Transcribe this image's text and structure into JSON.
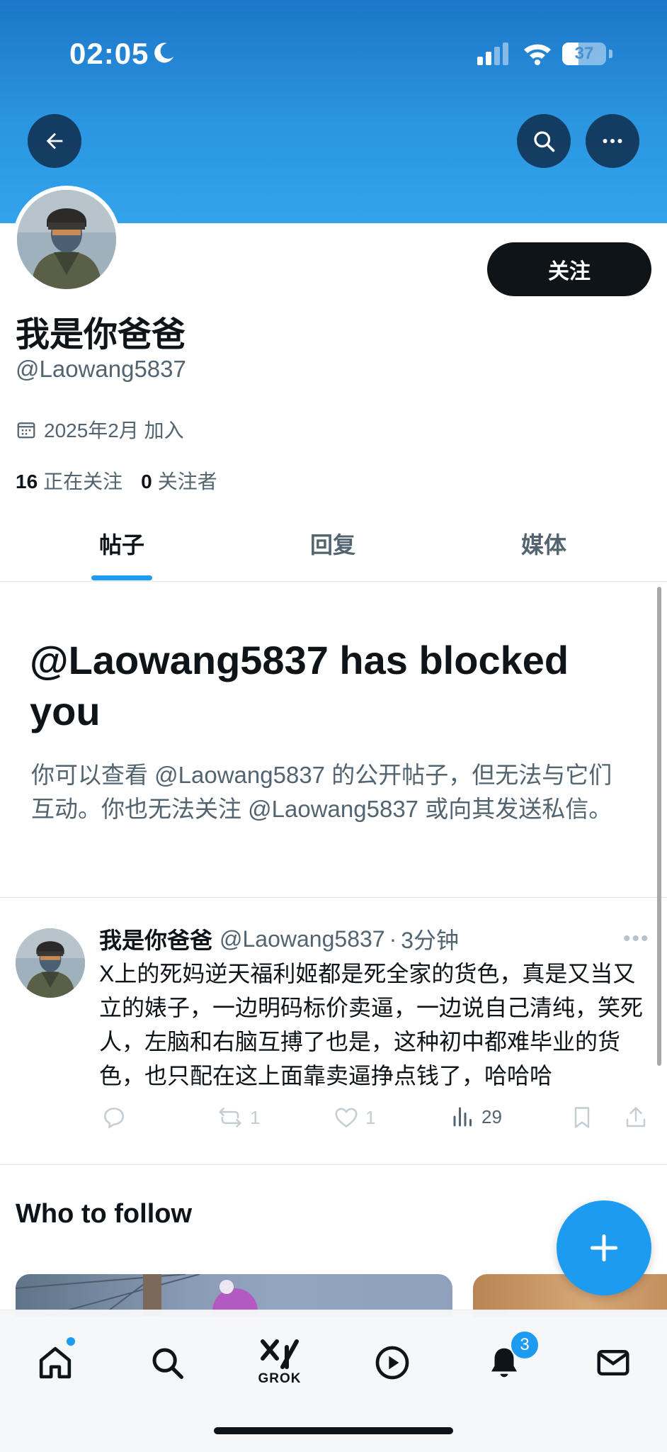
{
  "status_bar": {
    "time": "02:05",
    "battery": "37",
    "battery_level": 0.37
  },
  "header": {
    "back_icon": "arrow-left-icon",
    "search_icon": "search-icon",
    "more_icon": "more-horizontal-icon"
  },
  "profile": {
    "display_name": "我是你爸爸",
    "handle": "@Laowang5837",
    "follow_label": "关注",
    "joined": "2025年2月 加入",
    "following_count": "16",
    "following_label": "正在关注",
    "followers_count": "0",
    "followers_label": "关注者"
  },
  "tabs": [
    {
      "label": "帖子",
      "active": true
    },
    {
      "label": "回复",
      "active": false
    },
    {
      "label": "媒体",
      "active": false
    }
  ],
  "blocked": {
    "title": "@Laowang5837 has blocked you",
    "description": "你可以查看 @Laowang5837 的公开帖子，但无法与它们互动。你也无法关注 @Laowang5837 或向其发送私信。"
  },
  "post": {
    "name": "我是你爸爸",
    "handle": "@Laowang5837",
    "separator": "·",
    "time": "3分钟",
    "body": "X上的死妈逆天福利姬都是死全家的货色，真是又当又立的婊子，一边明码标价卖逼，一边说自己清纯，笑死人，左脑和右脑互搏了也是，这种初中都难毕业的货色，也只配在这上面靠卖逼挣点钱了，哈哈哈",
    "reposts": "1",
    "likes": "1",
    "views": "29"
  },
  "who_to_follow": {
    "title": "Who to follow"
  },
  "bottom_nav": {
    "grok_label": "GROK",
    "notifications_badge": "3"
  },
  "colors": {
    "accent": "#1d9bf0",
    "banner": "#2a95e0",
    "text_primary": "#0f1419",
    "text_secondary": "#536471"
  }
}
